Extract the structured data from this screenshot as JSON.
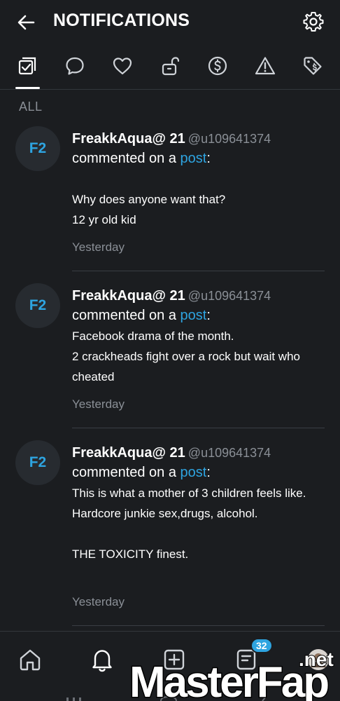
{
  "header": {
    "title": "NOTIFICATIONS",
    "back_icon": "arrow-left-icon",
    "settings_icon": "gear-icon"
  },
  "tabs": [
    {
      "icon": "checklist-icon",
      "active": true
    },
    {
      "icon": "speech-bubble-icon",
      "active": false
    },
    {
      "icon": "heart-icon",
      "active": false
    },
    {
      "icon": "unlock-icon",
      "active": false
    },
    {
      "icon": "dollar-circle-icon",
      "active": false
    },
    {
      "icon": "warning-triangle-icon",
      "active": false
    },
    {
      "icon": "price-tag-icon",
      "active": false
    }
  ],
  "section_label": "ALL",
  "notifications": [
    {
      "avatar": "F2",
      "name": "FreakkAqua@ 21",
      "handle": "@u109641374",
      "action": "commented on a ",
      "link": "post",
      "colon": ":",
      "message": "\nWhy does anyone want that?\n12 yr old kid",
      "time": "Yesterday"
    },
    {
      "avatar": "F2",
      "name": "FreakkAqua@ 21",
      "handle": "@u109641374",
      "action": "commented on a ",
      "link": "post",
      "colon": ":",
      "message": "Facebook drama of the month.\n2 crackheads fight over a rock but wait who cheated",
      "time": "Yesterday"
    },
    {
      "avatar": "F2",
      "name": "FreakkAqua@ 21",
      "handle": "@u109641374",
      "action": "commented on a ",
      "link": "post",
      "colon": ":",
      "message": "This is what a mother of 3 children feels like. Hardcore junkie sex,drugs, alcohol.\n\nTHE TOXICITY finest.",
      "time": "Yesterday"
    }
  ],
  "bottom_nav": {
    "items": [
      "home-icon",
      "bell-icon",
      "add-square-icon",
      "posts-icon",
      "profile-avatar"
    ],
    "badge": "32"
  },
  "watermark": {
    "text": "MasterFap",
    "suffix": ".net"
  },
  "colors": {
    "background": "#1b1d20",
    "accent": "#2ea4e0",
    "muted": "#8a8f96"
  }
}
